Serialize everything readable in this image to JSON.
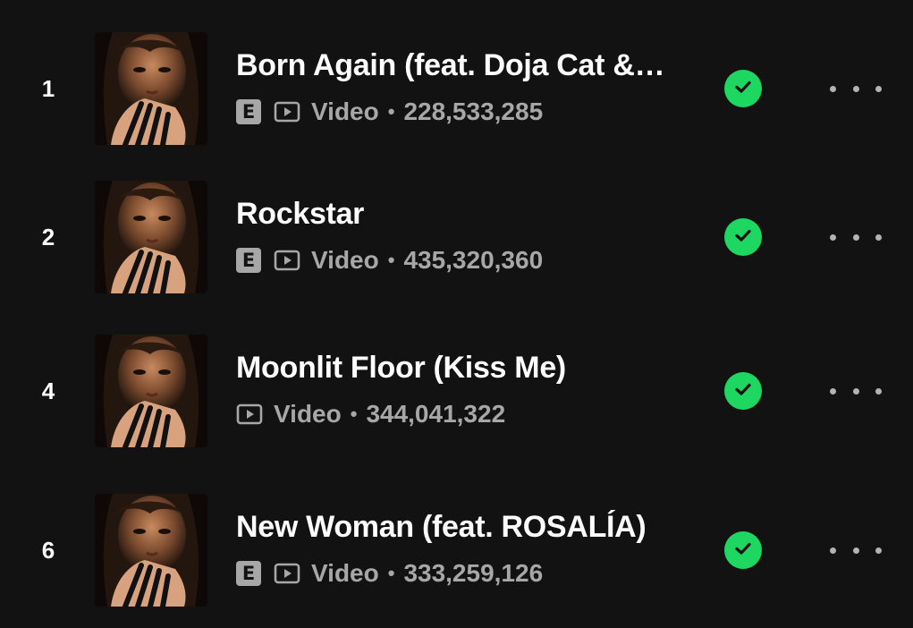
{
  "colors": {
    "background": "#121212",
    "primary_text": "#ffffff",
    "secondary_text": "#a7a7a7",
    "saved_accent": "#1ed760"
  },
  "icons": {
    "explicit": "explicit-badge",
    "video": "video-icon",
    "saved": "check-circle-icon",
    "more": "more-options-icon"
  },
  "tracks": [
    {
      "number": "1",
      "title": "Born Again (feat. Doja Cat &…",
      "explicit": true,
      "explicit_label": "E",
      "type_label": "Video",
      "separator": "•",
      "plays": "228,533,285",
      "saved": true
    },
    {
      "number": "2",
      "title": "Rockstar",
      "explicit": true,
      "explicit_label": "E",
      "type_label": "Video",
      "separator": "•",
      "plays": "435,320,360",
      "saved": true
    },
    {
      "number": "4",
      "title": "Moonlit Floor (Kiss Me)",
      "explicit": false,
      "explicit_label": "",
      "type_label": "Video",
      "separator": "•",
      "plays": "344,041,322",
      "saved": true
    },
    {
      "number": "6",
      "title": "New Woman (feat. ROSALÍA)",
      "explicit": true,
      "explicit_label": "E",
      "type_label": "Video",
      "separator": "•",
      "plays": "333,259,126",
      "saved": true
    }
  ]
}
